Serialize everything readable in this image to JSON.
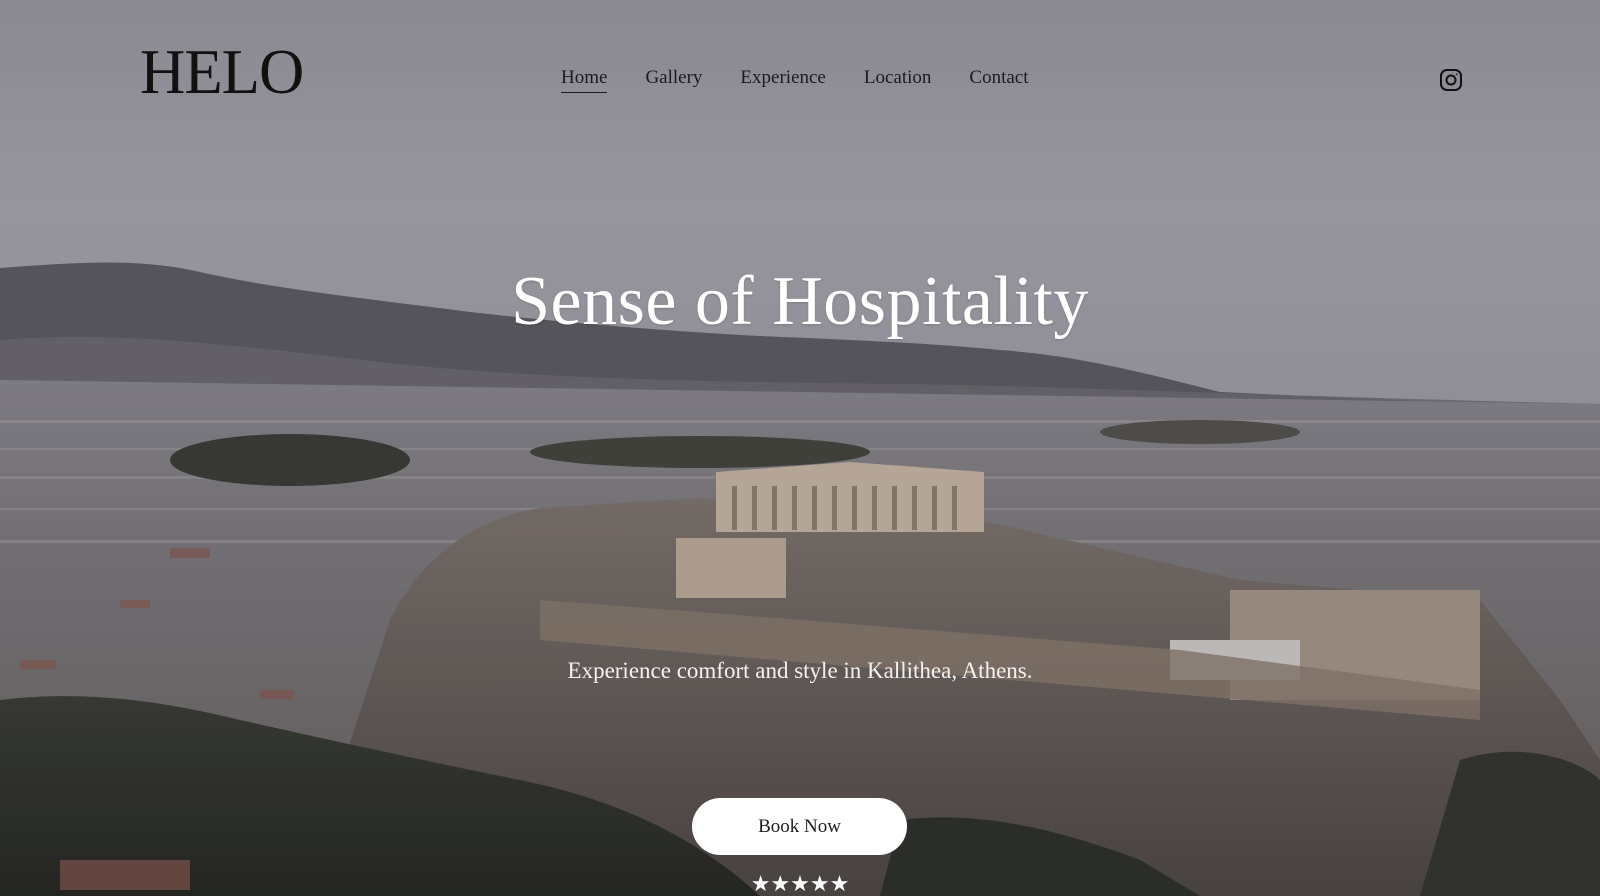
{
  "brand": {
    "logo_text": "HELO"
  },
  "nav": {
    "items": [
      {
        "label": "Home",
        "active": true
      },
      {
        "label": "Gallery",
        "active": false
      },
      {
        "label": "Experience",
        "active": false
      },
      {
        "label": "Location",
        "active": false
      },
      {
        "label": "Contact",
        "active": false
      }
    ]
  },
  "social": {
    "icon": "instagram-icon"
  },
  "hero": {
    "title": "Sense of Hospitality",
    "subtitle": "Experience comfort and style in Kallithea, Athens.",
    "cta_label": "Book Now",
    "rating_stars": "★★★★★",
    "rating_value": 5
  },
  "colors": {
    "text_dark": "#1b1b1f",
    "text_light": "#ffffff",
    "button_bg": "#ffffff"
  }
}
